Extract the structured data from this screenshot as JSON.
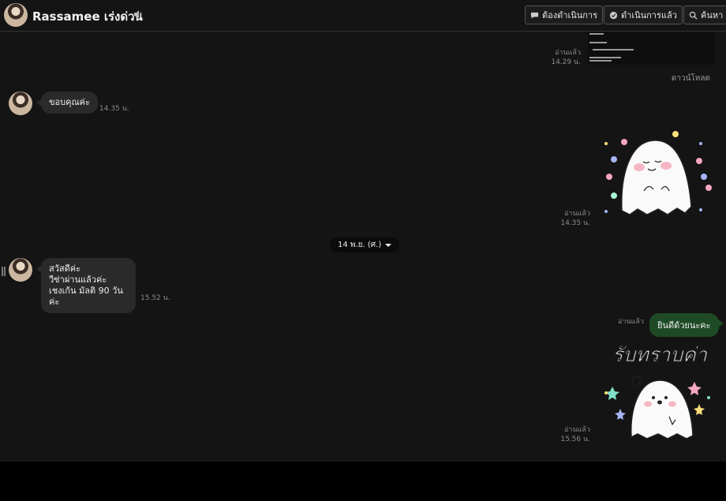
{
  "header": {
    "title": "Rassamee เร่งด่วน",
    "buttons": [
      {
        "label": "ต้องดำเนินการ"
      },
      {
        "label": "ดำเนินการแล้ว"
      },
      {
        "label": "ค้นหา"
      }
    ]
  },
  "messages": {
    "doc": {
      "read": "อ่านแล้ว",
      "time": "14.29 น.",
      "download": "ดาวน์โหลด"
    },
    "thanks": {
      "text": "ขอบคุณค่ะ",
      "time": "14.35 น."
    },
    "sticker1": {
      "read": "อ่านแล้ว",
      "time": "14.35 น."
    },
    "date_divider": "14 พ.ย. (ศ.)",
    "greeting": {
      "lines": [
        "สวัสดีค่ะ",
        "วีซ่าผ่านแล้วค่ะ",
        "เชงเก้น มัลติ 90 วันค่ะ"
      ],
      "time": "15.52 น."
    },
    "congrats": {
      "read": "อ่านแล้ว",
      "text": "ยินดีด้วยนะคะ"
    },
    "sticker2": {
      "caption": "รับทราบค่า",
      "read": "อ่านแล้ว",
      "time": "15.56 น."
    }
  },
  "colors": {
    "background": "#141414",
    "outgoing_bubble": "#1f4a26",
    "incoming_bubble": "#2a2a2a"
  }
}
